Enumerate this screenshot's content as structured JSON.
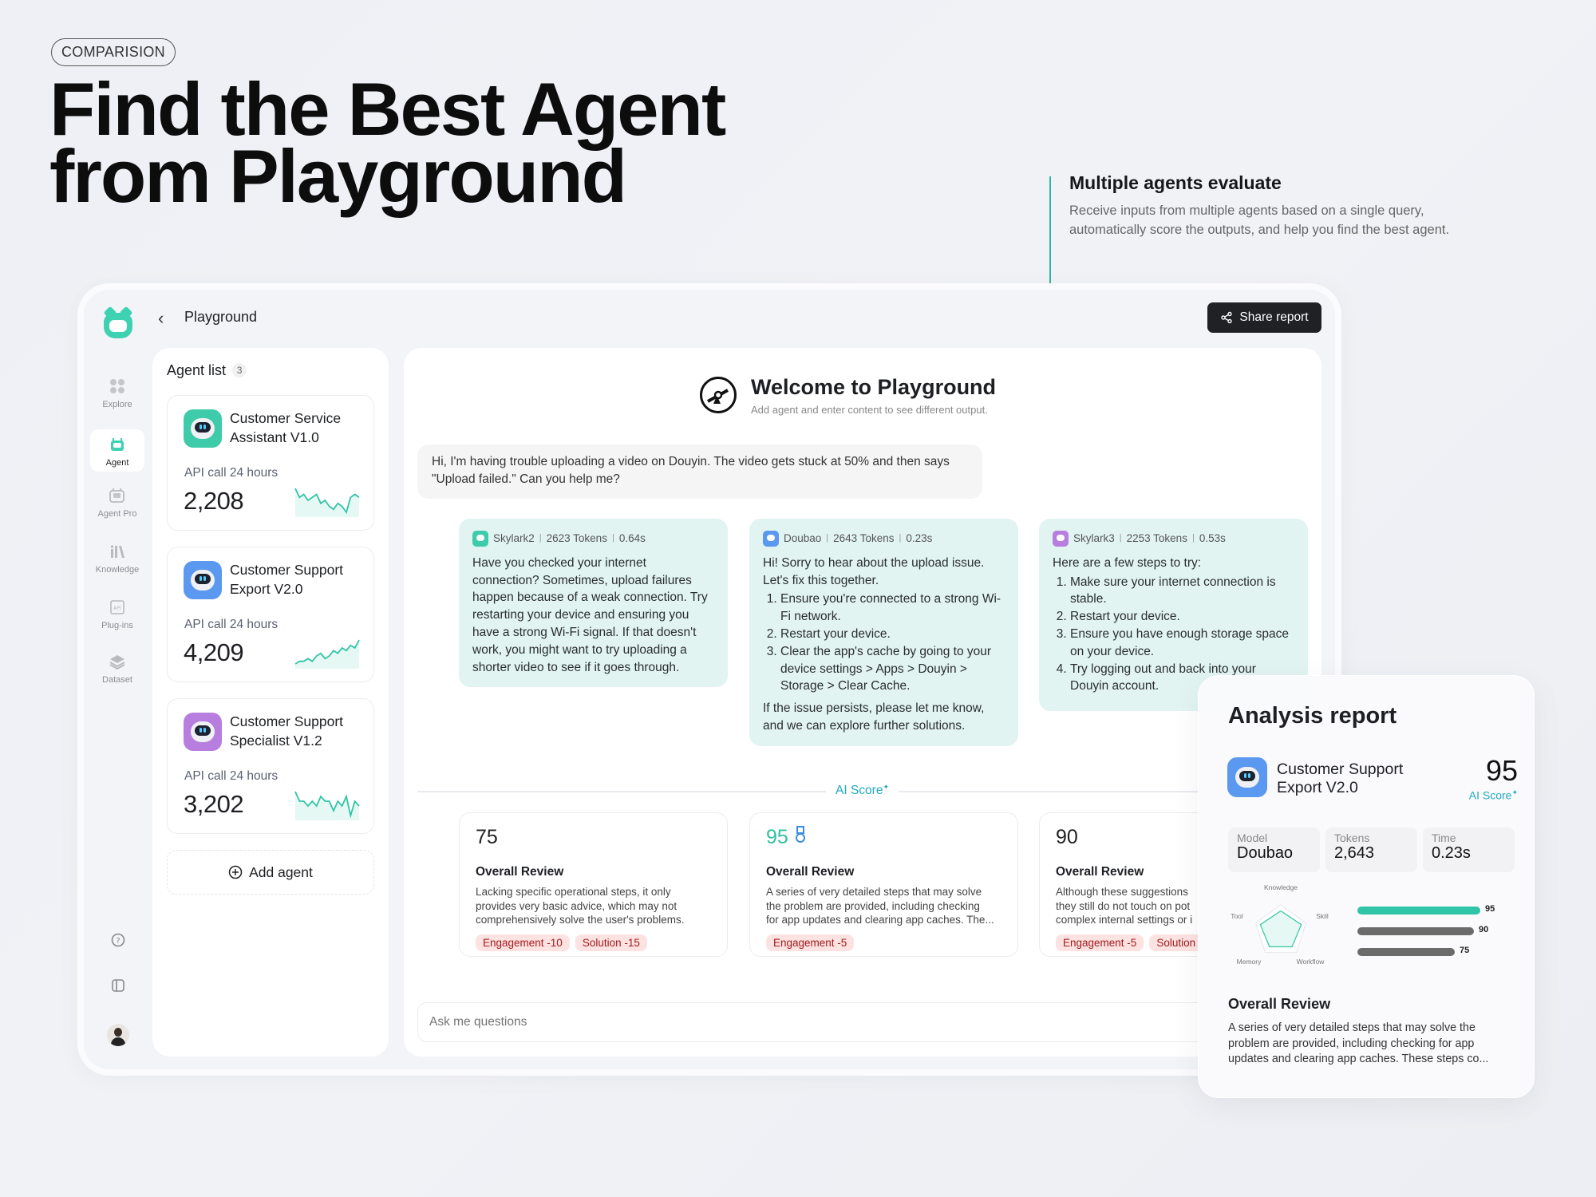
{
  "badge": "COMPARISION",
  "hero": {
    "line1": "Find the Best Agent",
    "line2": "from Playground"
  },
  "callout": {
    "title": "Multiple agents evaluate",
    "desc": "Receive inputs from multiple agents based on a single query, automatically score the outputs, and help you find the best agent."
  },
  "sidebar": {
    "items": [
      {
        "label": "Explore",
        "icon": "grid-icon"
      },
      {
        "label": "Agent",
        "icon": "robot-icon",
        "active": true
      },
      {
        "label": "Agent Pro",
        "icon": "robot-pro-icon"
      },
      {
        "label": "Knowledge",
        "icon": "library-icon"
      },
      {
        "label": "Plug-ins",
        "icon": "api-chip-icon"
      },
      {
        "label": "Dataset",
        "icon": "layers-icon"
      }
    ]
  },
  "header": {
    "title": "Playground",
    "share_label": "Share report"
  },
  "agent_list": {
    "title": "Agent list",
    "count": "3",
    "agents": [
      {
        "name": "Customer Service Assistant V1.0",
        "metric_label": "API call 24 hours",
        "value": "2,208",
        "color": "#3ecba9",
        "trend": [
          9,
          6,
          7,
          5,
          6,
          7,
          4,
          5,
          3,
          2,
          4,
          3,
          1,
          6,
          7,
          6
        ]
      },
      {
        "name": "Customer Support Export V2.0",
        "metric_label": "API call 24 hours",
        "value": "4,209",
        "color": "#5b98f0",
        "trend": [
          1,
          2,
          2,
          3,
          2,
          4,
          5,
          3,
          4,
          6,
          5,
          7,
          6,
          8,
          7,
          10
        ]
      },
      {
        "name": "Customer Support Specialist V1.2",
        "metric_label": "API call 24 hours",
        "value": "3,202",
        "color": "#b77ee0",
        "trend": [
          8,
          6,
          6,
          5,
          6,
          5,
          7,
          6,
          6,
          4,
          6,
          5,
          7,
          3,
          6,
          5
        ]
      }
    ],
    "add_label": "Add agent"
  },
  "welcome": {
    "title": "Welcome to Playground",
    "subtitle": "Add agent and enter content to see different output."
  },
  "user_message": "Hi, I'm having trouble uploading a video on Douyin. The video gets stuck at 50% and then says \"Upload failed.\" Can you help me?",
  "responses": [
    {
      "model": "Skylark2",
      "tokens": "2623 Tokens",
      "time": "0.64s",
      "color": "#3ecba9",
      "intro": "Have you checked your internet connection? Sometimes, upload failures happen because of a weak connection. Try restarting your device and ensuring you have a strong Wi-Fi signal. If that doesn't work, you might want to try uploading a shorter video to see if it goes through.",
      "steps": [],
      "outro": ""
    },
    {
      "model": "Doubao",
      "tokens": "2643 Tokens",
      "time": "0.23s",
      "color": "#5b98f0",
      "intro": "Hi! Sorry to hear about the upload issue. Let's fix this together.",
      "steps": [
        "Ensure you're connected to a strong Wi-Fi network.",
        "Restart your device.",
        "Clear the app's cache by going to your device settings > Apps > Douyin > Storage > Clear Cache."
      ],
      "outro": "If the issue persists, please let me know, and we can explore further solutions."
    },
    {
      "model": "Skylark3",
      "tokens": "2253 Tokens",
      "time": "0.53s",
      "color": "#b77ee0",
      "intro": "Here are a few steps to try:",
      "steps": [
        "Make sure your internet connection is stable.",
        "Restart your device.",
        "Ensure you have enough storage space on your device.",
        "Try logging out and back into your Douyin account."
      ],
      "outro": ""
    }
  ],
  "ai_score_label": "AI Score",
  "scores": [
    {
      "score": "75",
      "title": "Overall Review",
      "lines": [
        "Lacking specific operational steps, it only",
        "provides very basic advice, which may not",
        "comprehensively solve the user's problems."
      ],
      "tags": [
        "Engagement -10",
        "Solution -15"
      ]
    },
    {
      "score": "95",
      "best": true,
      "title": "Overall Review",
      "lines": [
        "A series of very detailed steps that may solve",
        "the problem are provided, including checking",
        "for app updates and clearing app caches. The..."
      ],
      "tags": [
        "Engagement -5"
      ]
    },
    {
      "score": "90",
      "title": "Overall Review",
      "lines": [
        "Although these suggestions",
        "they still do not touch on pot",
        "complex internal settings or i"
      ],
      "tags": [
        "Engagement -5",
        "Solution"
      ]
    }
  ],
  "input_placeholder": "Ask me questions",
  "report": {
    "title": "Analysis report",
    "agent": "Customer Support Export V2.0",
    "score": "95",
    "score_label": "AI Score",
    "stats": [
      {
        "label": "Model",
        "value": "Doubao"
      },
      {
        "label": "Tokens",
        "value": "2,643"
      },
      {
        "label": "Time",
        "value": "0.23s"
      }
    ],
    "radar": {
      "axes": [
        "Knowledge",
        "Skill",
        "Workflow",
        "Memory",
        "Tool"
      ],
      "values": [
        0.85,
        0.9,
        0.8,
        0.8,
        0.9
      ]
    },
    "bars": [
      {
        "value": 95,
        "color": "#2fc5a6"
      },
      {
        "value": 90,
        "color": "#6b6b6b"
      },
      {
        "value": 75,
        "color": "#6b6b6b"
      }
    ],
    "review_title": "Overall Review",
    "review": "A series of very detailed steps that may solve the problem are provided, including checking for app updates and clearing app caches. These steps co..."
  }
}
